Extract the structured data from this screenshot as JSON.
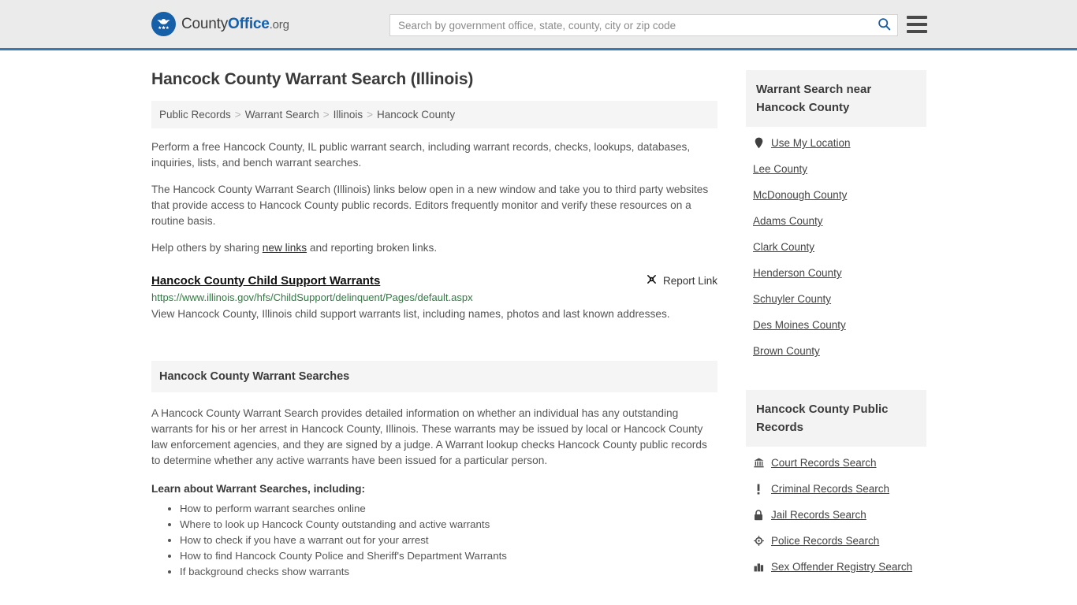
{
  "header": {
    "logo": {
      "icon": "eagle-shield-logo-icon",
      "text_county": "County",
      "text_office": "Office",
      "text_org": ".org"
    },
    "search": {
      "placeholder": "Search by government office, state, county, city or zip code",
      "value": "",
      "icon": "search-icon"
    },
    "menu_icon": "hamburger-menu-icon",
    "accent_color": "#3a7ab0"
  },
  "page": {
    "title": "Hancock County Warrant Search (Illinois)",
    "breadcrumb": [
      "Public Records",
      "Warrant Search",
      "Illinois",
      "Hancock County"
    ],
    "breadcrumb_separator": ">",
    "paragraphs": {
      "p1": "Perform a free Hancock County, IL public warrant search, including warrant records, checks, lookups, databases, inquiries, lists, and bench warrant searches.",
      "p2": "The Hancock County Warrant Search (Illinois) links below open in a new window and take you to third party websites that provide access to Hancock County public records. Editors frequently monitor and verify these resources on a routine basis.",
      "p3_before": "Help others by sharing ",
      "p3_link": "new links",
      "p3_after": " and reporting broken links."
    }
  },
  "result": {
    "title": "Hancock County Child Support Warrants",
    "url": "https://www.illinois.gov/hfs/ChildSupport/delinquent/Pages/default.aspx",
    "description": "View Hancock County, Illinois child support warrants list, including names, photos and last known addresses.",
    "report_label": "Report Link",
    "report_icon": "broken-link-icon",
    "url_color": "#2f7a41"
  },
  "section": {
    "heading": "Hancock County Warrant Searches",
    "body": "A Hancock County Warrant Search provides detailed information on whether an individual has any outstanding warrants for his or her arrest in Hancock County, Illinois. These warrants may be issued by local or Hancock County law enforcement agencies, and they are signed by a judge. A Warrant lookup checks Hancock County public records to determine whether any active warrants have been issued for a particular person.",
    "learn_title": "Learn about Warrant Searches, including:",
    "learn_items": [
      "How to perform warrant searches online",
      "Where to look up Hancock County outstanding and active warrants",
      "How to check if you have a warrant out for your arrest",
      "How to find Hancock County Police and Sheriff's Department Warrants",
      "If background checks show warrants"
    ]
  },
  "sidebar": {
    "nearby": {
      "heading": "Warrant Search near Hancock County",
      "items": [
        {
          "label": "Use My Location",
          "icon": "map-pin-icon"
        },
        {
          "label": "Lee County",
          "icon": ""
        },
        {
          "label": "McDonough County",
          "icon": ""
        },
        {
          "label": "Adams County",
          "icon": ""
        },
        {
          "label": "Clark County",
          "icon": ""
        },
        {
          "label": "Henderson County",
          "icon": ""
        },
        {
          "label": "Schuyler County",
          "icon": ""
        },
        {
          "label": "Des Moines County",
          "icon": ""
        },
        {
          "label": "Brown County",
          "icon": ""
        }
      ]
    },
    "public_records": {
      "heading": "Hancock County Public Records",
      "items": [
        {
          "label": "Court Records Search",
          "icon": "courthouse-icon"
        },
        {
          "label": "Criminal Records Search",
          "icon": "exclamation-icon"
        },
        {
          "label": "Jail Records Search",
          "icon": "lock-icon"
        },
        {
          "label": "Police Records Search",
          "icon": "police-badge-icon"
        },
        {
          "label": "Sex Offender Registry Search",
          "icon": "buildings-icon"
        }
      ]
    }
  }
}
